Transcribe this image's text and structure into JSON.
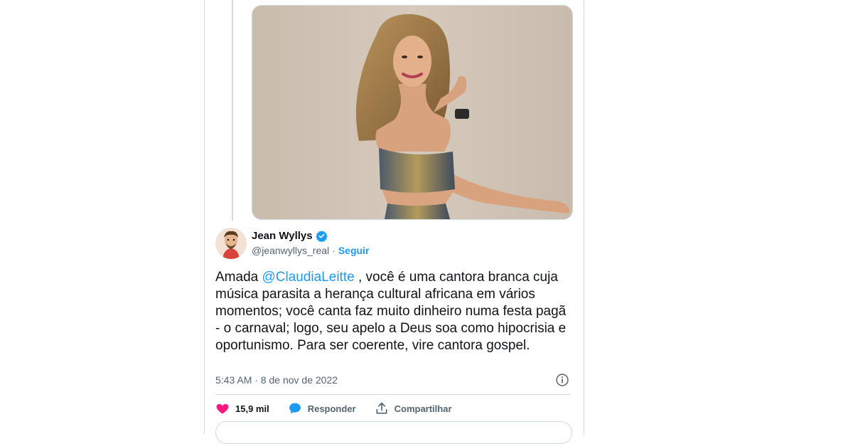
{
  "tweet": {
    "author_name": "Jean Wyllys",
    "author_handle": "@jeanwyllys_real",
    "follow_label": "Seguir",
    "text_before": "Amada ",
    "mention": "@ClaudiaLeitte",
    "text_after": " , você é uma cantora branca cuja música parasita a herança cultural africana em vários momentos; você canta faz muito dinheiro numa festa pagã - o carnaval; logo, seu apelo a Deus soa como hipocrisia e oportunismo. Para ser coerente, vire cantora gospel.",
    "timestamp": "5:43 AM · 8 de nov de 2022"
  },
  "actions": {
    "likes_count": "15,9 mil",
    "reply_label": "Responder",
    "share_label": "Compartilhar"
  },
  "colors": {
    "accent": "#1d9bf0",
    "like": "#f91880",
    "text": "#0f1419",
    "muted": "#536471",
    "border": "#cfd9de"
  },
  "icons": [
    "verified-badge-icon",
    "info-icon",
    "heart-icon",
    "reply-bubble-icon",
    "share-icon"
  ]
}
